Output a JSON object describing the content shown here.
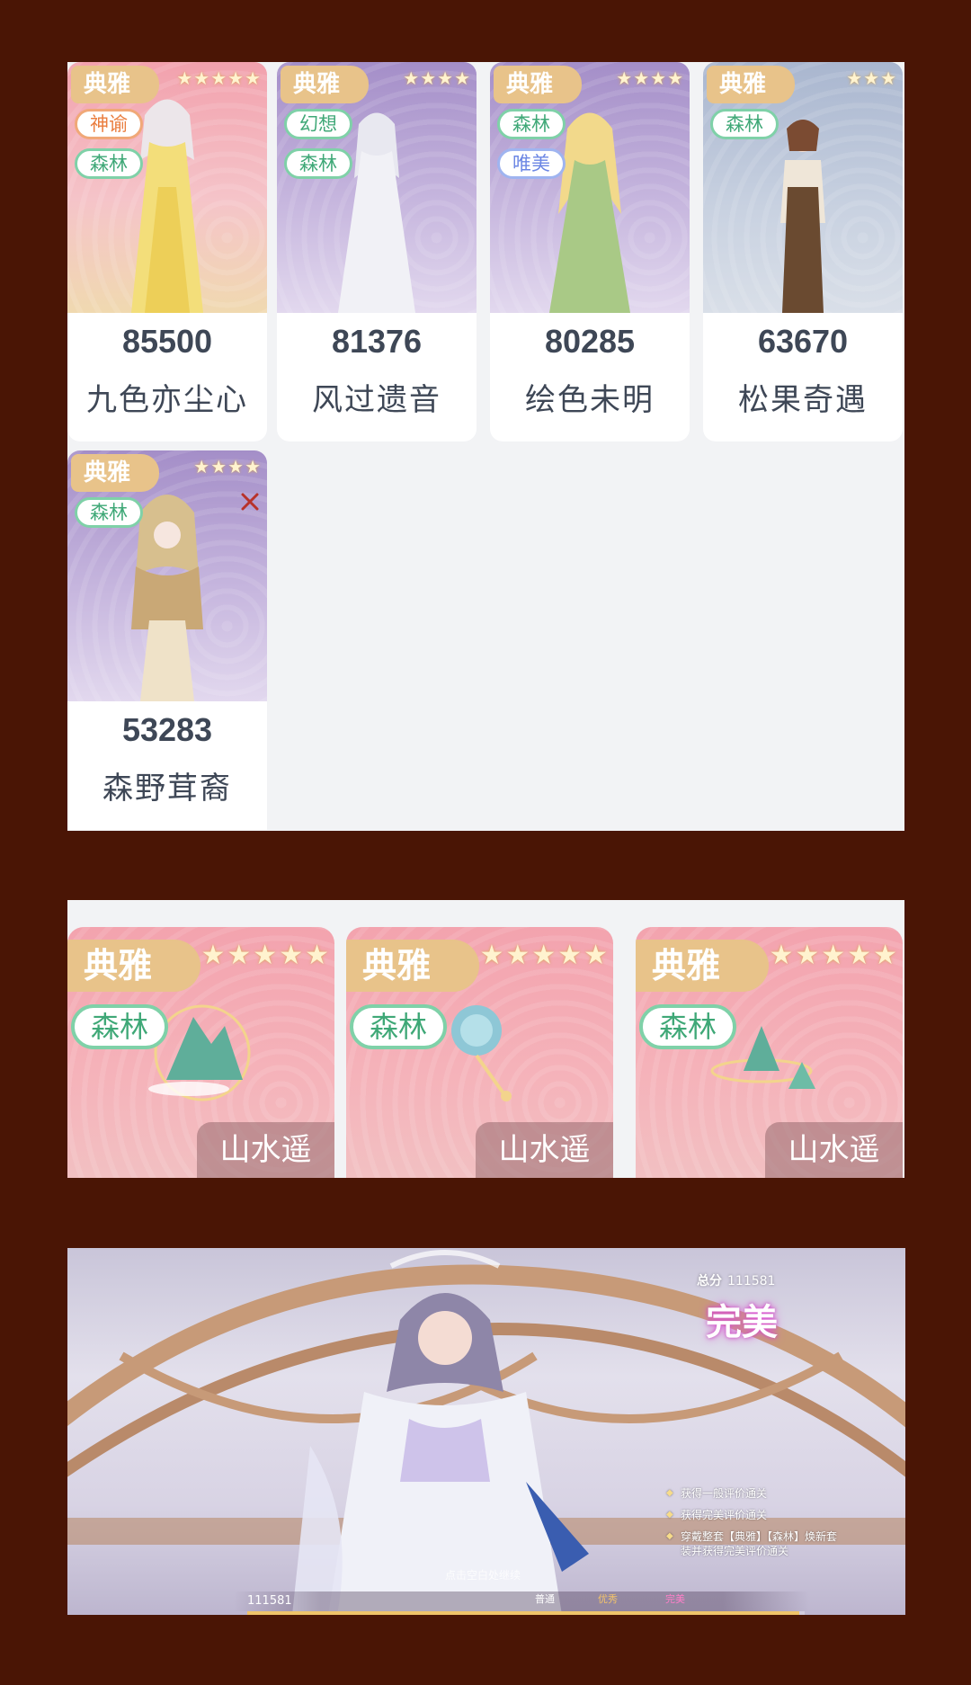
{
  "outfits": [
    {
      "rarity": "典雅",
      "stars": "★★★★★",
      "tags": [
        {
          "text": "神谕",
          "style": "orange"
        },
        {
          "text": "森林",
          "style": "green"
        }
      ],
      "score": "85500",
      "name": "九色亦尘心",
      "bg": "pink"
    },
    {
      "rarity": "典雅",
      "stars": "★★★★",
      "tags": [
        {
          "text": "幻想",
          "style": "green"
        },
        {
          "text": "森林",
          "style": "green"
        }
      ],
      "score": "81376",
      "name": "风过遗音",
      "bg": "purple"
    },
    {
      "rarity": "典雅",
      "stars": "★★★★",
      "tags": [
        {
          "text": "森林",
          "style": "green"
        },
        {
          "text": "唯美",
          "style": "blue"
        }
      ],
      "score": "80285",
      "name": "绘色未明",
      "bg": "purple"
    },
    {
      "rarity": "典雅",
      "stars": "★★★",
      "tags": [
        {
          "text": "森林",
          "style": "green"
        }
      ],
      "score": "63670",
      "name": "松果奇遇",
      "bg": "blue"
    },
    {
      "rarity": "典雅",
      "stars": "★★★★",
      "tags": [
        {
          "text": "森林",
          "style": "green"
        }
      ],
      "score": "53283",
      "name": "森野茸裔",
      "bg": "purple"
    }
  ],
  "accessories": [
    {
      "rarity": "典雅",
      "stars": "★★★★★",
      "tag": "森林",
      "set": "山水遥"
    },
    {
      "rarity": "典雅",
      "stars": "★★★★★",
      "tag": "森林",
      "set": "山水遥"
    },
    {
      "rarity": "典雅",
      "stars": "★★★★★",
      "tag": "森林",
      "set": "山水遥"
    }
  ],
  "game": {
    "total_label": "总分",
    "total_value": "111581",
    "grade": "完美",
    "objectives": [
      "获得一般评价通关",
      "获得完美评价通关",
      "穿戴整套【典雅】【森林】焕新套装并获得完美评价通关"
    ],
    "bottom_score": "111581",
    "hint": "点击空白处继续",
    "levels": [
      "普通",
      "优秀",
      "完美"
    ],
    "progress": 0.99
  },
  "colors": {
    "background": "#4a1505",
    "panel": "#f2f3f5",
    "rarity_gold": "#e8c38a",
    "tag_green": "#3fa877"
  }
}
